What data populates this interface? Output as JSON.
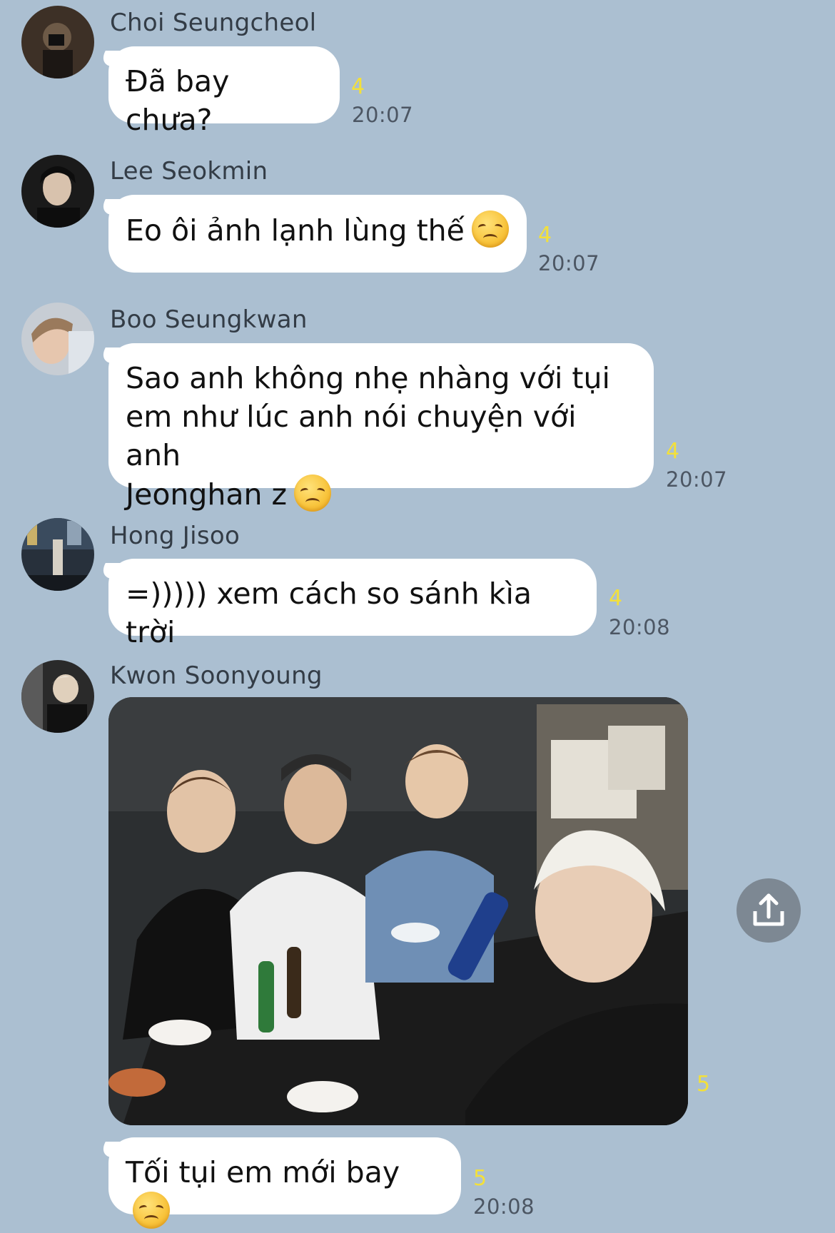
{
  "messages": [
    {
      "sender": "Choi Seungcheol",
      "text": "Đã bay chưa?",
      "count": "4",
      "time": "20:07"
    },
    {
      "sender": "Lee Seokmin",
      "text": "Eo ôi ảnh lạnh lùng thế",
      "emoji": "disappointed-face",
      "count": "4",
      "time": "20:07"
    },
    {
      "sender": "Boo Seungkwan",
      "lines": [
        "Sao anh không nhẹ nhàng với tụi",
        "em như lúc anh nói chuyện với anh",
        "Jeonghan z"
      ],
      "emoji": "disappointed-face",
      "count": "4",
      "time": "20:07"
    },
    {
      "sender": "Hong Jisoo",
      "text": "=))))) xem cách so sánh kìa trời",
      "count": "4",
      "time": "20:08"
    },
    {
      "sender": "Kwon Soonyoung",
      "photo_count": "5",
      "text": "Tối tụi em mới bay",
      "emoji": "disappointed-face",
      "count": "5",
      "time": "20:08"
    }
  ],
  "icons": {
    "share": "share-upload-icon"
  },
  "colors": {
    "background": "#abbfd1",
    "bubble": "#ffffff",
    "read_count": "#f3e03a",
    "time": "#4c5663"
  }
}
